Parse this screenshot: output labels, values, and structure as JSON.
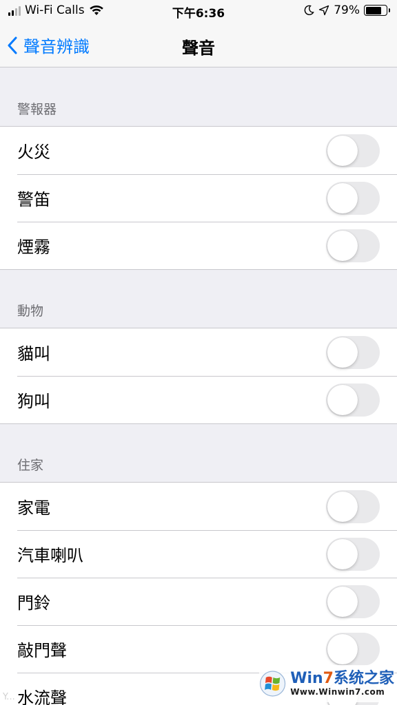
{
  "status_bar": {
    "carrier": "Wi-Fi Calls",
    "time": "下午6:36",
    "battery": "79%",
    "battery_level": 0.79,
    "icons": [
      "signal-icon",
      "wifi-icon",
      "moon-icon",
      "location-arrow-icon",
      "battery-icon"
    ]
  },
  "nav": {
    "back_label": "聲音辨識",
    "title": "聲音"
  },
  "sections": [
    {
      "header": "警報器",
      "rows": [
        {
          "label": "火災",
          "on": false
        },
        {
          "label": "警笛",
          "on": false
        },
        {
          "label": "煙霧",
          "on": false
        }
      ]
    },
    {
      "header": "動物",
      "rows": [
        {
          "label": "貓叫",
          "on": false
        },
        {
          "label": "狗叫",
          "on": false
        }
      ]
    },
    {
      "header": "住家",
      "rows": [
        {
          "label": "家電",
          "on": false
        },
        {
          "label": "汽車喇叭",
          "on": false
        },
        {
          "label": "門鈴",
          "on": false
        },
        {
          "label": "敲門聲",
          "on": false
        },
        {
          "label": "水流聲",
          "on": false
        }
      ]
    }
  ],
  "watermark": {
    "brand_prefix": "Win",
    "brand_seven": "7",
    "brand_suffix": "系统之家",
    "url": "Www.Winwin7.com",
    "faint_text": "Y..."
  },
  "colors": {
    "accent": "#007aff",
    "background": "#efeff4",
    "toggle_off": "#e9e9eb",
    "separator": "#c8c7cc",
    "section_header": "#6d6d72"
  }
}
